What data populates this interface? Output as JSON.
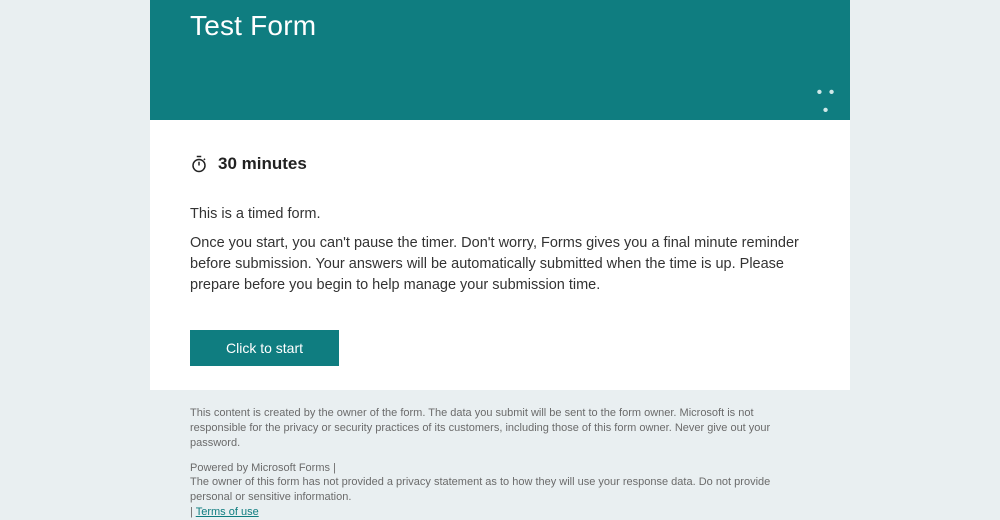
{
  "header": {
    "title": "Test Form",
    "more_dots": "• • •"
  },
  "timer": {
    "icon_name": "stopwatch-icon",
    "duration_label": "30 minutes"
  },
  "notice": {
    "line1": "This is a timed form.",
    "line2": "Once you start, you can't pause the timer. Don't worry, Forms gives you a final minute reminder before submission. Your answers will be automatically submitted when the time is up. Please prepare before you begin to help manage your submission time."
  },
  "start_button_label": "Click to start",
  "footer": {
    "disclaimer": "This content is created by the owner of the form. The data you submit will be sent to the form owner. Microsoft is not responsible for the privacy or security practices of its customers, including those of this form owner. Never give out your password.",
    "powered_by": "Powered by Microsoft Forms",
    "privacy_notice": "The owner of this form has not provided a privacy statement as to how they will use your response data. Do not provide personal or sensitive information.",
    "terms_link_label": "Terms of use"
  }
}
